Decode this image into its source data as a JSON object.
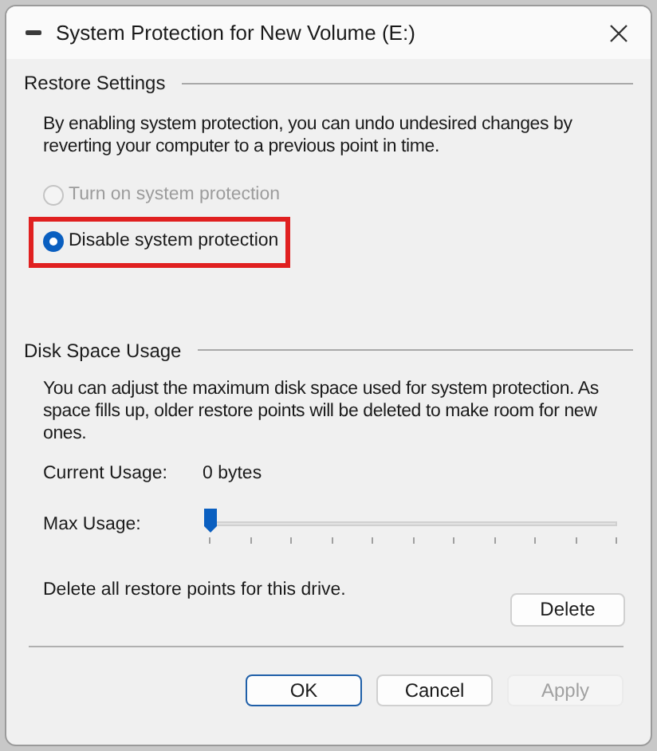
{
  "window": {
    "title": "System Protection for New Volume (E:)"
  },
  "restore_settings": {
    "heading": "Restore Settings",
    "description": "By enabling system protection, you can undo undesired changes by reverting your computer to a previous point in time.",
    "options": [
      {
        "label": "Turn on system protection",
        "selected": false,
        "disabled": true,
        "highlighted": false
      },
      {
        "label": "Disable system protection",
        "selected": true,
        "disabled": false,
        "highlighted": true
      }
    ]
  },
  "disk_space_usage": {
    "heading": "Disk Space Usage",
    "description": "You can adjust the maximum disk space used for system protection. As space fills up, older restore points will be deleted to make room for new ones.",
    "current_usage_label": "Current Usage:",
    "current_usage_value": "0 bytes",
    "max_usage_label": "Max Usage:",
    "max_usage": {
      "level": 0
    },
    "delete_text": "Delete all restore points for this drive.",
    "delete_button": "Delete"
  },
  "buttons": [
    {
      "label": "OK",
      "default": true,
      "disabled": false
    },
    {
      "label": "Cancel",
      "default": false,
      "disabled": false
    },
    {
      "label": "Apply",
      "default": false,
      "disabled": true
    }
  ]
}
